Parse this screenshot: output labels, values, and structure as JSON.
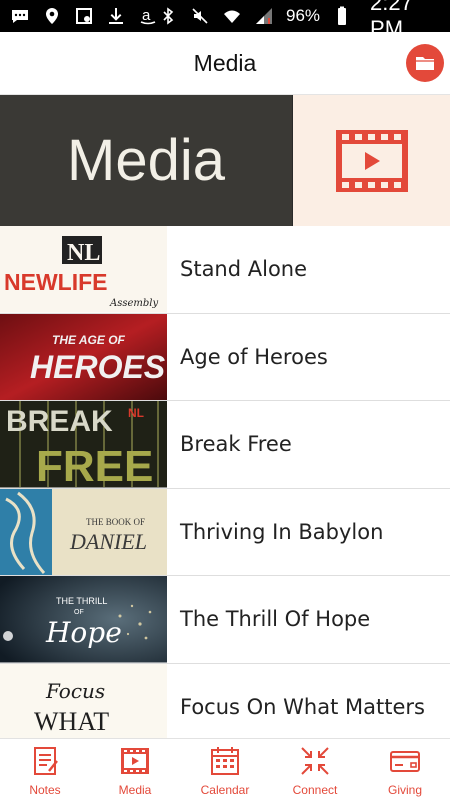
{
  "status_bar": {
    "battery": "96%",
    "time": "2:27 PM",
    "icons_left": [
      "message-icon",
      "location-icon",
      "screenshot-icon",
      "download-icon",
      "amazon-icon"
    ],
    "icons_right": [
      "bluetooth-icon",
      "mute-icon",
      "wifi-icon",
      "signal-icon",
      "battery-icon"
    ]
  },
  "header": {
    "title": "Media",
    "action_icon": "folder-icon"
  },
  "hero": {
    "title": "Media",
    "icon": "video-film-icon"
  },
  "media_items": [
    {
      "label": "Stand Alone",
      "thumb_text": "NEWLIFE"
    },
    {
      "label": "Age of Heroes",
      "thumb_text": "THE AGE OF HEROES"
    },
    {
      "label": "Break Free",
      "thumb_text": "BREAK FREE"
    },
    {
      "label": "Thriving In Babylon",
      "thumb_text": "THE BOOK OF DANIEL"
    },
    {
      "label": "The Thrill Of Hope",
      "thumb_text": "THE THRILL OF Hope"
    },
    {
      "label": "Focus On What Matters",
      "thumb_text": "Focus WHAT"
    }
  ],
  "bottom_nav": [
    {
      "label": "Notes",
      "icon": "notes-icon"
    },
    {
      "label": "Media",
      "icon": "media-icon"
    },
    {
      "label": "Calendar",
      "icon": "calendar-icon"
    },
    {
      "label": "Connect",
      "icon": "connect-icon"
    },
    {
      "label": "Giving",
      "icon": "giving-card-icon"
    }
  ],
  "colors": {
    "accent": "#e3493a",
    "hero_dark": "#3a3935",
    "hero_light": "#fbeee4"
  }
}
